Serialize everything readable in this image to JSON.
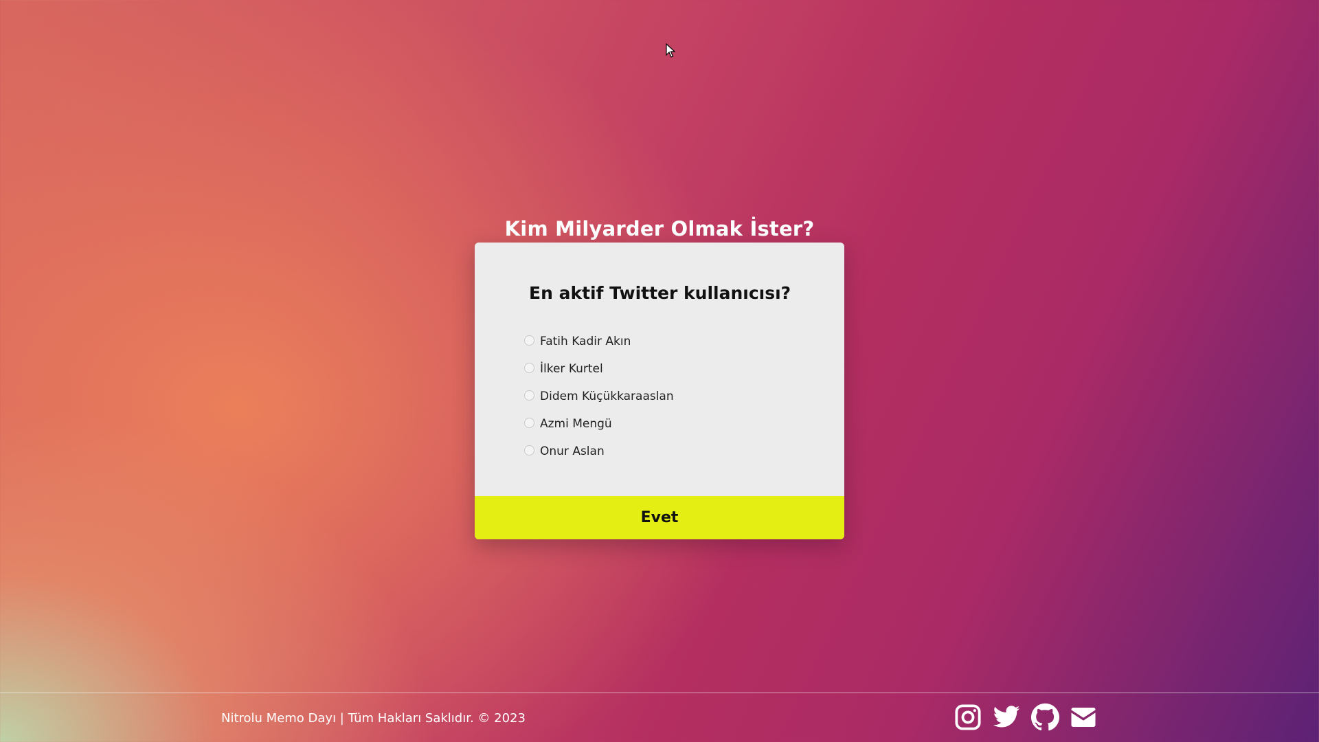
{
  "page": {
    "title": "Kim Milyarder Olmak İster?"
  },
  "quiz": {
    "question": "En aktif Twitter kullanıcısı?",
    "options": [
      {
        "label": "Fatih Kadir Akın",
        "selected": false
      },
      {
        "label": "İlker Kurtel",
        "selected": false
      },
      {
        "label": "Didem Küçükkaraaslan",
        "selected": false
      },
      {
        "label": "Azmi Mengü",
        "selected": false
      },
      {
        "label": "Onur Aslan",
        "selected": false
      }
    ],
    "submit_label": "Evet"
  },
  "footer": {
    "copyright": "Nitrolu Memo Dayı | Tüm Hakları Saklıdır. © 2023",
    "social": [
      {
        "icon": "instagram-icon"
      },
      {
        "icon": "twitter-icon"
      },
      {
        "icon": "github-icon"
      },
      {
        "icon": "mail-icon"
      }
    ]
  },
  "colors": {
    "button": "#e4ee12",
    "card": "#ececec",
    "text_light": "#ffffff"
  }
}
